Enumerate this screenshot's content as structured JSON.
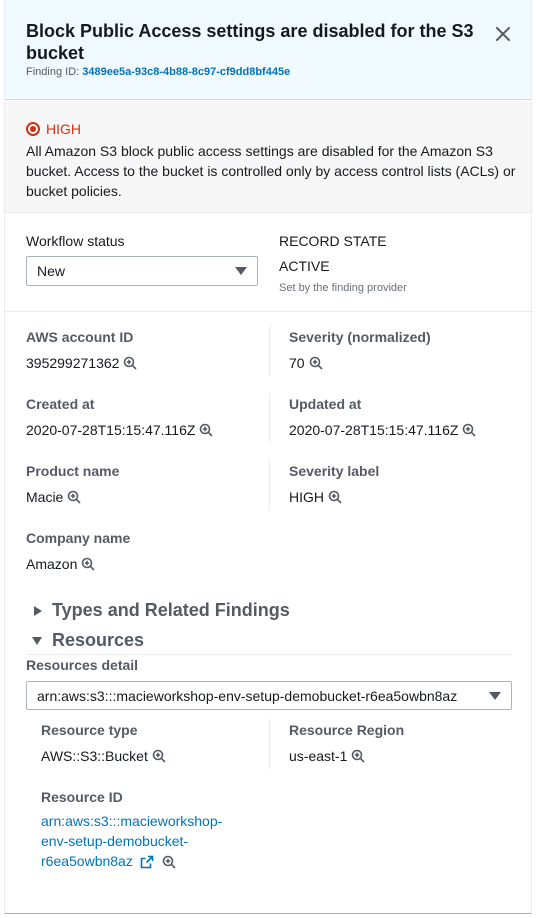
{
  "header": {
    "title": "Block Public Access settings are disabled for the S3 bucket",
    "finding_label": "Finding ID:",
    "finding_id": "3489ee5a-93c8-4b88-8c97-cf9dd8bf445e"
  },
  "severity": {
    "label": "HIGH",
    "description": "All Amazon S3 block public access settings are disabled for the Amazon S3 bucket. Access to the bucket is controlled only by access control lists (ACLs) or bucket policies."
  },
  "workflow": {
    "label": "Workflow status",
    "value": "New"
  },
  "record_state": {
    "label": "RECORD STATE",
    "value": "ACTIVE",
    "note": "Set by the finding provider"
  },
  "fields": {
    "account_id": {
      "label": "AWS account ID",
      "value": "395299271362"
    },
    "severity_normalized": {
      "label": "Severity (normalized)",
      "value": "70"
    },
    "created_at": {
      "label": "Created at",
      "value": "2020-07-28T15:15:47.116Z"
    },
    "updated_at": {
      "label": "Updated at",
      "value": "2020-07-28T15:15:47.116Z"
    },
    "product_name": {
      "label": "Product name",
      "value": "Macie"
    },
    "severity_label": {
      "label": "Severity label",
      "value": "HIGH"
    },
    "company_name": {
      "label": "Company name",
      "value": "Amazon"
    }
  },
  "sections": {
    "types": "Types and Related Findings",
    "resources": "Resources"
  },
  "resources": {
    "detail_label": "Resources detail",
    "selected": "arn:aws:s3:::macieworkshop-env-setup-demobucket-r6ea5owbn8az",
    "type_label": "Resource type",
    "type_value": "AWS::S3::Bucket",
    "region_label": "Resource Region",
    "region_value": "us-east-1",
    "id_label": "Resource ID",
    "id_line1": "arn:aws:s3:::macieworkshop-",
    "id_line2": "env-setup-demobucket-",
    "id_line3": "r6ea5owbn8az"
  },
  "colors": {
    "accent": "#0073bb",
    "severity_high": "#d13212",
    "header_bg": "#f1faff"
  },
  "icons": [
    "close-icon",
    "zoom-in-icon",
    "external-link-icon",
    "chevron-down-icon",
    "caret-right-icon"
  ]
}
